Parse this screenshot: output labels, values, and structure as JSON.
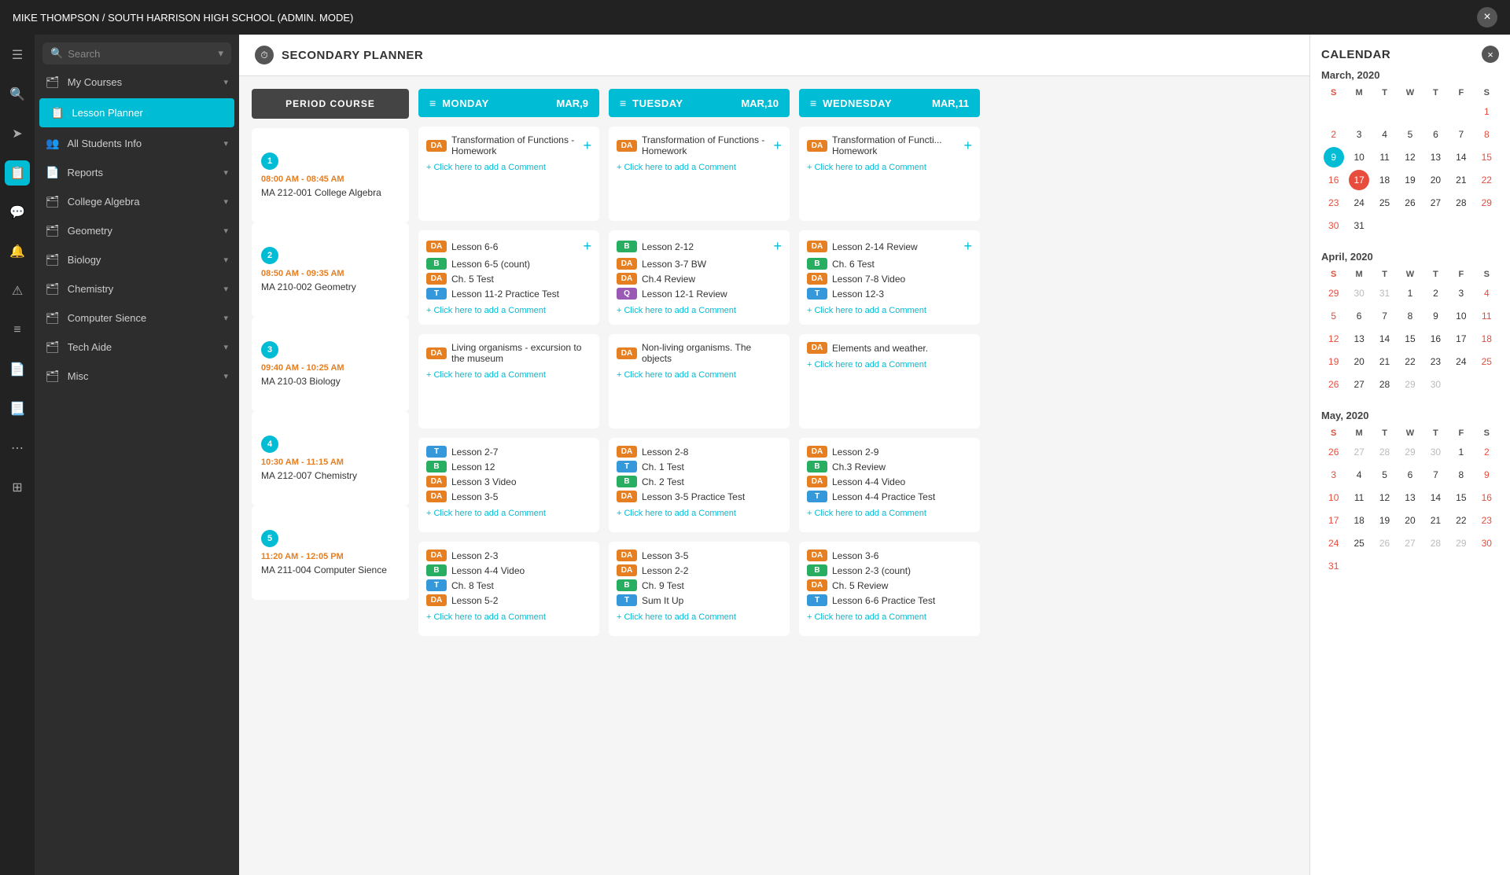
{
  "topbar": {
    "title": "MIKE THOMPSON / SOUTH HARRISON HIGH SCHOOL (ADMIN. MODE)",
    "close_label": "×"
  },
  "sidebar": {
    "search_placeholder": "Search",
    "items": [
      {
        "id": "my-courses",
        "label": "My Courses",
        "icon": "🗂",
        "active": false,
        "expandable": true
      },
      {
        "id": "lesson-planner",
        "label": "Lesson Planner",
        "icon": "📋",
        "active": true,
        "expandable": false
      },
      {
        "id": "all-students-info",
        "label": "All Students Info",
        "icon": "👥",
        "active": false,
        "expandable": true
      },
      {
        "id": "reports",
        "label": "Reports",
        "icon": "📄",
        "active": false,
        "expandable": true
      },
      {
        "id": "college-algebra",
        "label": "College Algebra",
        "icon": "🗂",
        "active": false,
        "expandable": true
      },
      {
        "id": "geometry",
        "label": "Geometry",
        "icon": "🗂",
        "active": false,
        "expandable": true
      },
      {
        "id": "biology",
        "label": "Biology",
        "icon": "🗂",
        "active": false,
        "expandable": true
      },
      {
        "id": "chemistry",
        "label": "Chemistry",
        "icon": "🗂",
        "active": false,
        "expandable": true
      },
      {
        "id": "computer-sience",
        "label": "Computer Sience",
        "icon": "🗂",
        "active": false,
        "expandable": true
      },
      {
        "id": "tech-aide",
        "label": "Tech Aide",
        "icon": "🗂",
        "active": false,
        "expandable": true
      },
      {
        "id": "misc",
        "label": "Misc",
        "icon": "🗂",
        "active": false,
        "expandable": true
      }
    ]
  },
  "planner": {
    "title": "SECONDARY PLANNER",
    "periods": [
      {
        "num": "1",
        "time": "08:00 AM - 08:45 AM",
        "course": "MA 212-001 College Algebra"
      },
      {
        "num": "2",
        "time": "08:50 AM - 09:35 AM",
        "course": "MA 210-002 Geometry"
      },
      {
        "num": "3",
        "time": "09:40 AM - 10:25 AM",
        "course": "MA 210-03 Biology"
      },
      {
        "num": "4",
        "time": "10:30 AM - 11:15 AM",
        "course": "MA 212-007 Chemistry"
      },
      {
        "num": "5",
        "time": "11:20 AM - 12:05 PM",
        "course": "MA 211-004 Computer Sience"
      }
    ],
    "period_col_header": "PERIOD COURSE",
    "days": [
      {
        "name": "MONDAY",
        "date": "MAR,9",
        "cells": [
          {
            "lessons": [
              {
                "badge": "DA",
                "text": "Transformation of Functions - Homework"
              }
            ],
            "comment": "Click here to add a Comment"
          },
          {
            "lessons": [
              {
                "badge": "DA",
                "text": "Lesson 6-6"
              },
              {
                "badge": "B",
                "text": "Lesson 6-5 (count)"
              },
              {
                "badge": "DA",
                "text": "Ch. 5 Test"
              },
              {
                "badge": "T",
                "text": "Lesson 11-2 Practice Test"
              }
            ],
            "comment": "Click here to add a Comment"
          },
          {
            "lessons": [
              {
                "badge": "DA",
                "text": "Living organisms - excursion to the museum"
              }
            ],
            "comment": "Click here to add a Comment"
          },
          {
            "lessons": [
              {
                "badge": "T",
                "text": "Lesson 2-7"
              },
              {
                "badge": "B",
                "text": "Lesson 12"
              },
              {
                "badge": "DA",
                "text": "Lesson 3 Video"
              },
              {
                "badge": "DA",
                "text": "Lesson 3-5"
              }
            ],
            "comment": "Click here to add a Comment"
          },
          {
            "lessons": [
              {
                "badge": "DA",
                "text": "Lesson 2-3"
              },
              {
                "badge": "B",
                "text": "Lesson 4-4 Video"
              },
              {
                "badge": "T",
                "text": "Ch. 8 Test"
              },
              {
                "badge": "DA",
                "text": "Lesson 5-2"
              }
            ],
            "comment": "Click here to add a Comment"
          }
        ]
      },
      {
        "name": "TUESDAY",
        "date": "MAR,10",
        "cells": [
          {
            "lessons": [
              {
                "badge": "DA",
                "text": "Transformation of Functions - Homework"
              }
            ],
            "comment": "Click here to add a Comment"
          },
          {
            "lessons": [
              {
                "badge": "B",
                "text": "Lesson 2-12"
              },
              {
                "badge": "DA",
                "text": "Lesson 3-7 BW"
              },
              {
                "badge": "DA",
                "text": "Ch.4 Review"
              },
              {
                "badge": "Q",
                "text": "Lesson 12-1 Review"
              }
            ],
            "comment": "Click here to add a Comment"
          },
          {
            "lessons": [
              {
                "badge": "DA",
                "text": "Non-living organisms. The objects"
              }
            ],
            "comment": "Click here to add a Comment"
          },
          {
            "lessons": [
              {
                "badge": "DA",
                "text": "Lesson 2-8"
              },
              {
                "badge": "T",
                "text": "Ch. 1 Test"
              },
              {
                "badge": "B",
                "text": "Ch. 2 Test"
              },
              {
                "badge": "DA",
                "text": "Lesson 3-5 Practice Test"
              }
            ],
            "comment": "Click here to add a Comment"
          },
          {
            "lessons": [
              {
                "badge": "DA",
                "text": "Lesson 3-5"
              },
              {
                "badge": "DA",
                "text": "Lesson 2-2"
              },
              {
                "badge": "B",
                "text": "Ch. 9 Test"
              },
              {
                "badge": "T",
                "text": "Sum It Up"
              }
            ],
            "comment": "Click here to add a Comment"
          }
        ]
      },
      {
        "name": "WEDNESDAY",
        "date": "MAR,11",
        "cells": [
          {
            "lessons": [
              {
                "badge": "DA",
                "text": "Transformation of Functi... Homework"
              }
            ],
            "comment": "Click here to add a Comment"
          },
          {
            "lessons": [
              {
                "badge": "DA",
                "text": "Lesson 2-14 Review"
              },
              {
                "badge": "B",
                "text": "Ch. 6 Test"
              },
              {
                "badge": "DA",
                "text": "Lesson 7-8 Video"
              },
              {
                "badge": "T",
                "text": "Lesson 12-3"
              }
            ],
            "comment": "Click here to add a Comment"
          },
          {
            "lessons": [
              {
                "badge": "DA",
                "text": "Elements and weather."
              }
            ],
            "comment": "Click here to add a Comment"
          },
          {
            "lessons": [
              {
                "badge": "DA",
                "text": "Lesson 2-9"
              },
              {
                "badge": "B",
                "text": "Ch.3 Review"
              },
              {
                "badge": "DA",
                "text": "Lesson 4-4 Video"
              },
              {
                "badge": "T",
                "text": "Lesson 4-4 Practice Test"
              }
            ],
            "comment": "Click here to add a Comment"
          },
          {
            "lessons": [
              {
                "badge": "DA",
                "text": "Lesson 3-6"
              },
              {
                "badge": "B",
                "text": "Lesson 2-3 (count)"
              },
              {
                "badge": "DA",
                "text": "Ch. 5 Review"
              },
              {
                "badge": "T",
                "text": "Lesson 6-6 Practice Test"
              }
            ],
            "comment": "Click here to add a Comment"
          }
        ]
      }
    ]
  },
  "calendar": {
    "title": "CALENDAR",
    "close_label": "×",
    "months": [
      {
        "title": "March, 2020",
        "dow": [
          "S",
          "M",
          "T",
          "W",
          "T",
          "F",
          "S"
        ],
        "weeks": [
          [
            "",
            "",
            "",
            "",
            "",
            "",
            "1"
          ],
          [
            "2",
            "3",
            "4",
            "5",
            "6",
            "7",
            "8"
          ],
          [
            "9",
            "10",
            "11",
            "12",
            "13",
            "14",
            "15"
          ],
          [
            "16",
            "17",
            "18",
            "19",
            "20",
            "21",
            "22"
          ],
          [
            "23",
            "24",
            "25",
            "26",
            "27",
            "28",
            "29"
          ],
          [
            "30",
            "31",
            "",
            "",
            "",
            "",
            ""
          ]
        ],
        "today": "9",
        "selected": "17",
        "faded": []
      },
      {
        "title": "April, 2020",
        "dow": [
          "S",
          "M",
          "T",
          "W",
          "T",
          "F",
          "S"
        ],
        "weeks": [
          [
            "29",
            "30",
            "31",
            "1",
            "2",
            "3",
            "4"
          ],
          [
            "5",
            "6",
            "7",
            "8",
            "9",
            "10",
            "11"
          ],
          [
            "12",
            "13",
            "14",
            "15",
            "16",
            "17",
            "18"
          ],
          [
            "19",
            "20",
            "21",
            "22",
            "23",
            "24",
            "25"
          ],
          [
            "26",
            "27",
            "28",
            "29",
            "30",
            "",
            ""
          ]
        ],
        "today": "",
        "selected": "",
        "faded": [
          "29",
          "30",
          "31"
        ]
      },
      {
        "title": "May, 2020",
        "dow": [
          "S",
          "M",
          "T",
          "W",
          "T",
          "F",
          "S"
        ],
        "weeks": [
          [
            "26",
            "27",
            "28",
            "29",
            "30",
            "1",
            "2"
          ],
          [
            "3",
            "4",
            "5",
            "6",
            "7",
            "8",
            "9"
          ],
          [
            "10",
            "11",
            "12",
            "13",
            "14",
            "15",
            "16"
          ],
          [
            "17",
            "18",
            "19",
            "20",
            "21",
            "22",
            "23"
          ],
          [
            "24",
            "25",
            "26",
            "27",
            "28",
            "29",
            "30"
          ],
          [
            "31",
            "",
            "",
            "",
            "",
            "",
            ""
          ]
        ],
        "today": "",
        "selected": "",
        "faded": [
          "26",
          "27",
          "28",
          "29",
          "30"
        ]
      }
    ]
  }
}
